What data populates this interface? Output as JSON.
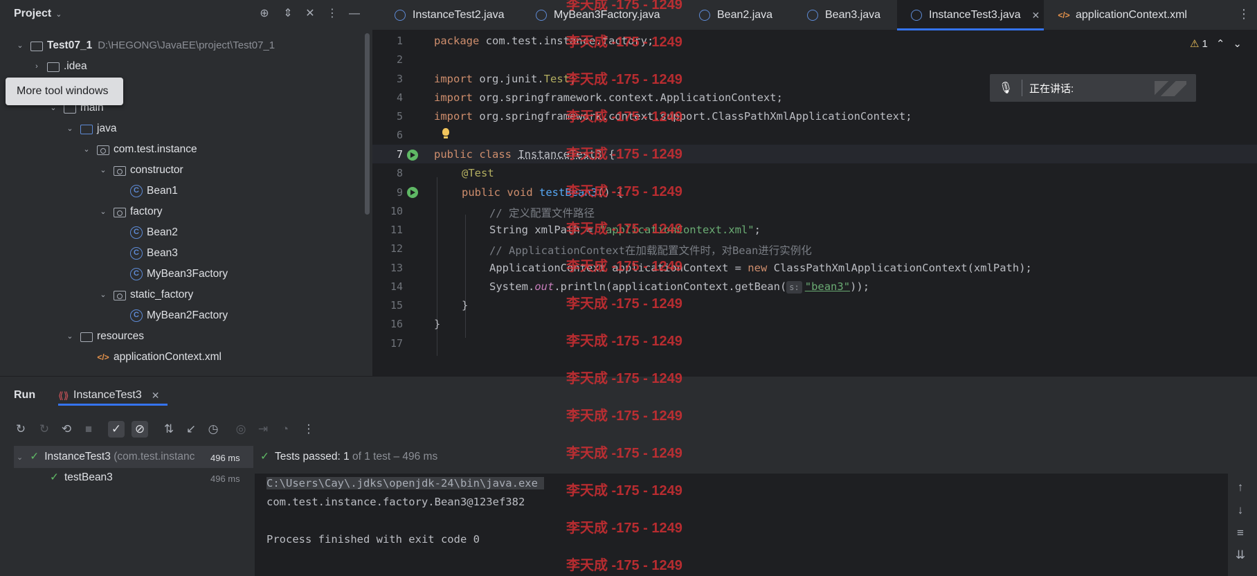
{
  "project": {
    "title": "Project",
    "tooltip": "More tool windows",
    "tree": [
      {
        "label": "Test07_1",
        "extra": "D:\\HEGONG\\JavaEE\\project\\Test07_1"
      },
      {
        "label": ".idea"
      },
      {
        "label": "main"
      },
      {
        "label": "java"
      },
      {
        "label": "com.test.instance"
      },
      {
        "label": "constructor"
      },
      {
        "label": "Bean1"
      },
      {
        "label": "factory"
      },
      {
        "label": "Bean2"
      },
      {
        "label": "Bean3"
      },
      {
        "label": "MyBean3Factory"
      },
      {
        "label": "static_factory"
      },
      {
        "label": "MyBean2Factory"
      },
      {
        "label": "resources"
      },
      {
        "label": "applicationContext.xml"
      }
    ]
  },
  "tabs": [
    {
      "label": "InstanceTest2.java"
    },
    {
      "label": "MyBean3Factory.java"
    },
    {
      "label": "Bean2.java"
    },
    {
      "label": "Bean3.java"
    },
    {
      "label": "InstanceTest3.java"
    },
    {
      "label": "applicationContext.xml"
    }
  ],
  "editor": {
    "warning_count": "1",
    "line_numbers": [
      "1",
      "2",
      "3",
      "4",
      "5",
      "6",
      "7",
      "8",
      "9",
      "10",
      "11",
      "12",
      "13",
      "14",
      "15",
      "16",
      "17"
    ],
    "lines": {
      "l1_kw": "package",
      "l1_rest": " com.test.instance.factory;",
      "l3_kw": "import",
      "l3_a": " org.junit.",
      "l3_b": "Test",
      "l3_c": ";",
      "l4_kw": "import",
      "l4_rest": " org.springframework.context.ApplicationContext;",
      "l5_kw": "import",
      "l5_rest": " org.springframework.context.support.ClassPathXmlApplicationContext;",
      "l7_kw": "public class",
      "l7_name": "InstanceTest3",
      "l7_rest": " {",
      "l8": "@Test",
      "l9_kw": "public void",
      "l9_fn": "testBean3",
      "l9_rest": "() {",
      "l10": "// 定义配置文件路径",
      "l11_a": "String xmlPath = ",
      "l11_str": "\"applicationContext.xml\"",
      "l11_c": ";",
      "l12": "// ApplicationContext在加载配置文件时，对Bean进行实例化",
      "l13_a": "ApplicationContext applicationContext = ",
      "l13_kw": "new",
      "l13_b": " ClassPathXmlApplicationContext(xmlPath);",
      "l14_a": "System.",
      "l14_st": "out",
      "l14_b": ".println(applicationContext.getBean(",
      "l14_hint": "s:",
      "l14_str": "\"bean3\"",
      "l14_c": "));",
      "l15": "}",
      "l16": "}"
    }
  },
  "speaking": {
    "label": "正在讲话:"
  },
  "watermark": "李天成 -175 - 1249",
  "run": {
    "title": "Run",
    "tab_label": "InstanceTest3",
    "tests": [
      {
        "name": "InstanceTest3",
        "detail": "(com.test.instanc",
        "time": "496 ms"
      },
      {
        "name": "testBean3",
        "time": "496 ms"
      }
    ],
    "status_a": "Tests passed: ",
    "status_b": "1",
    "status_c": " of 1 test – 496 ms",
    "console": [
      "C:\\Users\\Cay\\.jdks\\openjdk-24\\bin\\java.exe ",
      "com.test.instance.factory.Bean3@123ef382",
      "",
      "Process finished with exit code 0"
    ]
  }
}
